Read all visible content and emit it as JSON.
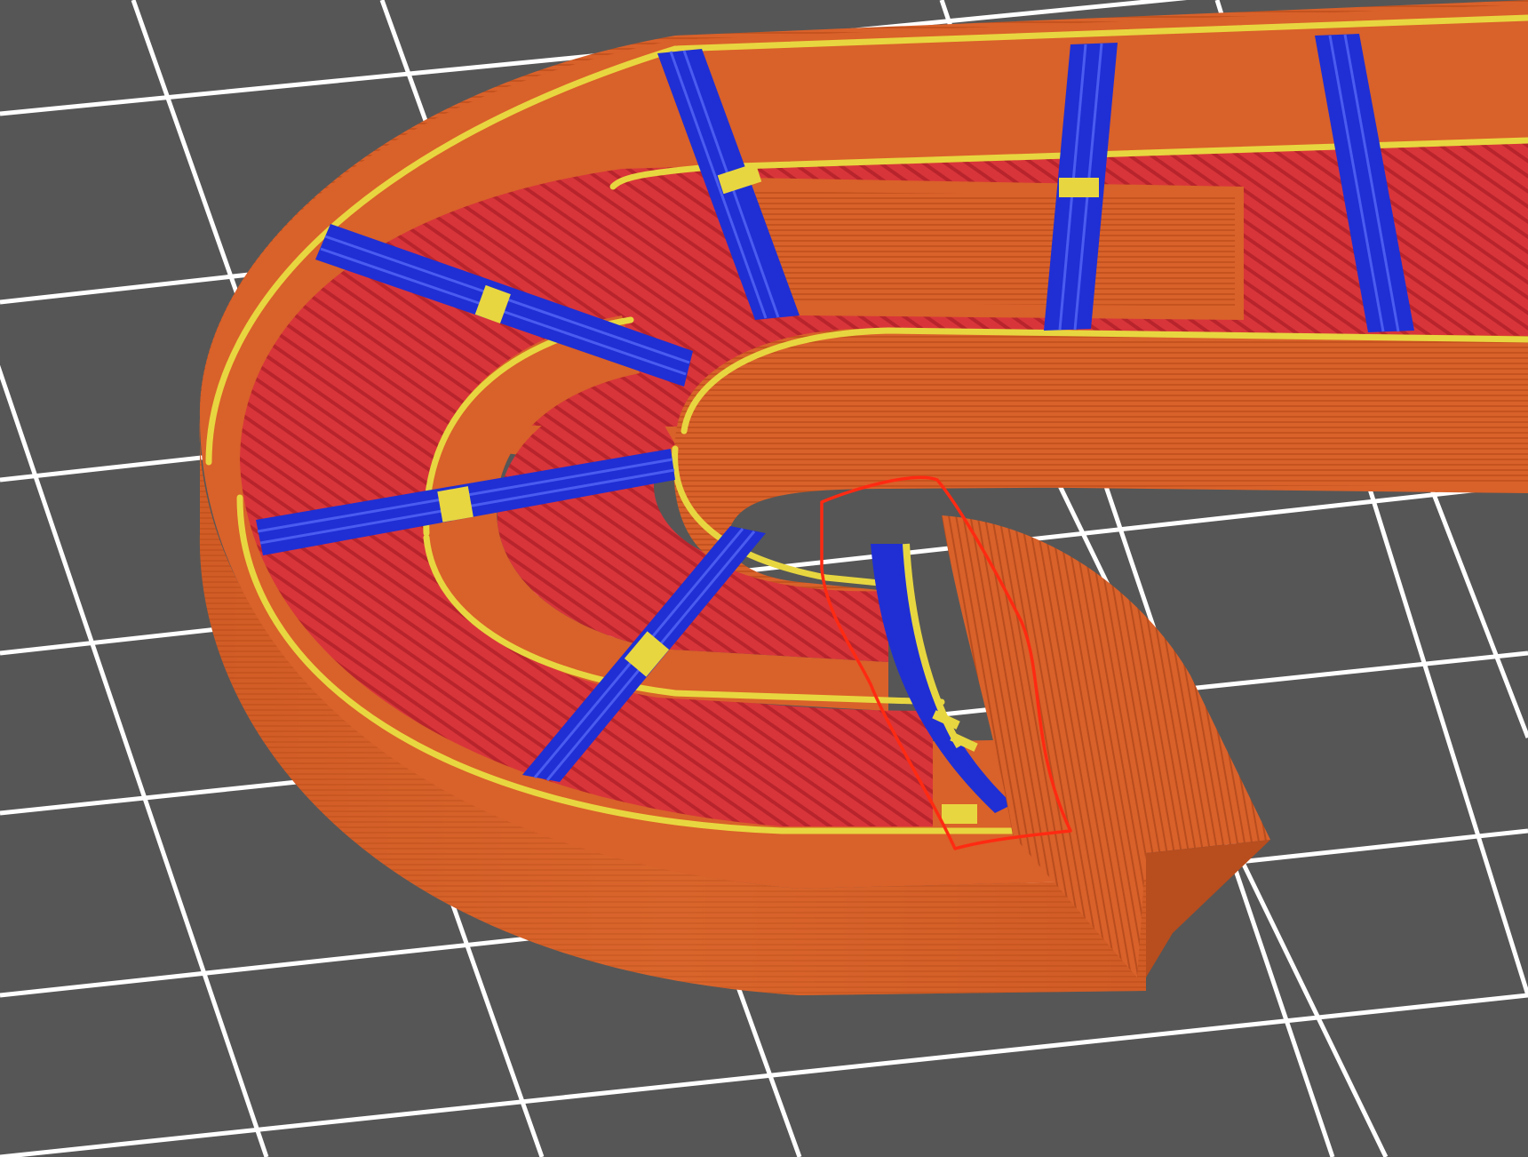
{
  "app": {
    "view": "slicer-3d-preview"
  },
  "colors": {
    "background": "#565656",
    "bed_grid_line": "#ffffff",
    "external_perimeter": "#d9612a",
    "external_perimeter_dark": "#b84d1e",
    "perimeter": "#e8d640",
    "internal_infill": "#d8353a",
    "internal_infill_stripe": "#b8242c",
    "bridge_infill": "#1f2fd4",
    "bridge_infill_light": "#4a5cf0",
    "annotation_outline": "#ff2a12"
  },
  "legend_roles": [
    "external-perimeter",
    "perimeter",
    "internal-infill",
    "bridge-infill",
    "annotation"
  ]
}
